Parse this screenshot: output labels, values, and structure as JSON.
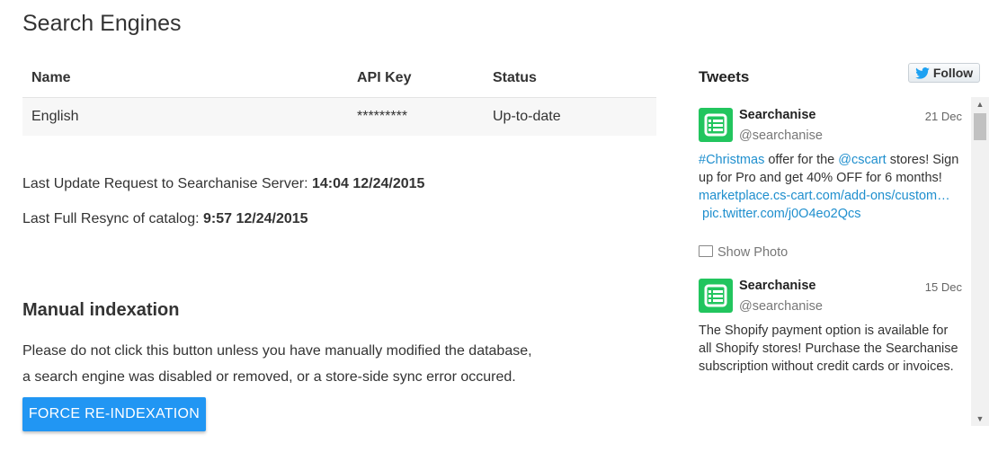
{
  "page": {
    "title": "Search Engines"
  },
  "table": {
    "headers": {
      "name": "Name",
      "api_key": "API Key",
      "status": "Status"
    },
    "rows": [
      {
        "name": "English",
        "api_key": "*********",
        "status": "Up-to-date"
      }
    ]
  },
  "info": {
    "last_update_label": "Last Update Request to Searchanise Server:",
    "last_update_value": "14:04 12/24/2015",
    "last_resync_label": "Last Full Resync of catalog:",
    "last_resync_value": "9:57 12/24/2015"
  },
  "manual": {
    "title": "Manual indexation",
    "notice_line1": "Please do not click this button unless you have manually modified the database,",
    "notice_line2": "a search engine was disabled or removed, or a store-side sync error occured.",
    "button_label": "FORCE RE-INDEXATION"
  },
  "tweets": {
    "title": "Tweets",
    "follow_label": "Follow",
    "items": [
      {
        "name": "Searchanise",
        "handle": "@searchanise",
        "date": "21 Dec",
        "hashtag": "#Christmas",
        "text1": " offer for the ",
        "mention": "@cscart",
        "text2": " stores! Sign up for Pro and get 40% OFF for 6 months!",
        "link1": "marketplace.cs-cart.com/add-ons/custom…",
        "link2": "pic.twitter.com/j0O4eo2Qcs",
        "show_photo": "Show Photo"
      },
      {
        "name": "Searchanise",
        "handle": "@searchanise",
        "date": "15 Dec",
        "text": "The Shopify payment option is available for all Shopify stores! Purchase the Searchanise subscription  without credit cards or invoices."
      }
    ]
  },
  "colors": {
    "accent": "#2196f3",
    "status_ok": "#2a8a2a",
    "link": "#1f8fce",
    "avatar": "#22c55e"
  }
}
